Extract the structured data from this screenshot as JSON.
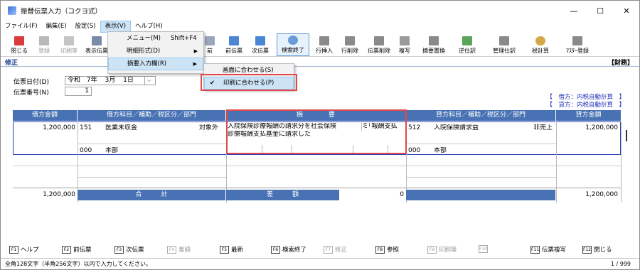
{
  "window": {
    "title": "振替伝票入力（コクヨ式）",
    "controls": {
      "minimize": "—",
      "maximize": "☐",
      "close": "✕"
    }
  },
  "menu": [
    "ファイル(F)",
    "編集(E)",
    "設定(S)",
    "表示(V)",
    "ヘルプ(H)"
  ],
  "toolbar": {
    "close": "閉じる",
    "register": "登録",
    "print": "印刷等",
    "display": "表示伝票",
    "prev": "前伝票",
    "next": "次伝票",
    "search_end": "検索終了",
    "insert_row": "行挿入",
    "delete_row": "行削除",
    "delete_voucher": "伝票削除",
    "copy": "複写",
    "summary_replace": "摘要置換",
    "reverse": "逆仕訳",
    "management": "管理仕訳",
    "tax": "税計算",
    "master": "ﾏｽﾀｰ登録",
    "more_mark": "前"
  },
  "mode": "修正",
  "department": "【財務】",
  "form": {
    "date_label": "伝票日付(D)",
    "era": "令和",
    "year": "7年",
    "month": "3月",
    "day": "1日",
    "number_label": "伝票番号(N)",
    "number": "1"
  },
  "tax_info": {
    "debit": "【　借方：内税自動計算　】",
    "credit": "【　貸方：内税自動計算　】"
  },
  "grid": {
    "headers": {
      "debit_amount": "借方金額",
      "debit_account": "借方科目／補助／税区分／部門",
      "summary": "摘　　　　要",
      "credit_account": "貸方科目／補助／税区分／部門",
      "credit_amount": "貸方金額"
    },
    "row": {
      "debit_amount": "1,200,000",
      "debit_code": "151",
      "debit_name": "医業未収金",
      "debit_tax": "対象外",
      "debit_dept_code": "000",
      "debit_dept": "本部",
      "summary_line1": "入院保険診療報酬の請求分を社会保険",
      "summary_line2": "診療報酬支払基金に請求した",
      "summary_popup": "ミ｢報酬支払",
      "credit_code": "512",
      "credit_name": "入院保険請求益",
      "credit_tax": "非売上",
      "credit_dept_code": "000",
      "credit_dept": "本部",
      "credit_amount": "1,200,000"
    },
    "totals": {
      "debit": "1,200,000",
      "label_total": "合　　　計",
      "label_diff": "差　　　額",
      "diff": "0",
      "credit": "1,200,000"
    }
  },
  "fkeys": [
    {
      "key": "F1",
      "label": "ヘルプ",
      "enabled": true
    },
    {
      "key": "F2",
      "label": "前伝票",
      "enabled": true
    },
    {
      "key": "F3",
      "label": "次伝票",
      "enabled": true
    },
    {
      "key": "F4",
      "label": "差額",
      "enabled": false
    },
    {
      "key": "F5",
      "label": "最新",
      "enabled": true
    },
    {
      "key": "F6",
      "label": "検索終了",
      "enabled": true
    },
    {
      "key": "F7",
      "label": "修正",
      "enabled": false
    },
    {
      "key": "F8",
      "label": "参照",
      "enabled": true
    },
    {
      "key": "F9",
      "label": "印刷等",
      "enabled": false
    },
    {
      "key": "F10",
      "label": "",
      "enabled": false
    },
    {
      "key": "F11",
      "label": "伝票複写",
      "enabled": true
    },
    {
      "key": "F12",
      "label": "閉じる",
      "enabled": true
    }
  ],
  "status": {
    "hint": "全角128文字（半角256文字）以内で入力してください。",
    "page": "1 / 999"
  },
  "view_menu": {
    "items": [
      {
        "label": "メニュー(M)",
        "shortcut": "Shift+F4",
        "submenu": false
      },
      {
        "label": "明細形式(D)",
        "shortcut": "",
        "submenu": true
      },
      {
        "label": "摘要入力欄(R)",
        "shortcut": "",
        "submenu": true
      }
    ],
    "submenu": [
      {
        "label": "画面に合わせる(S)",
        "checked": false
      },
      {
        "label": "印刷に合わせる(P)",
        "checked": true
      }
    ]
  },
  "icons": {
    "check": "✔",
    "submenu_arrow": "▶"
  },
  "colors": {
    "header_blue": "#4872b4",
    "highlight_red": "#e0484d",
    "selection_blue": "#1c2fb8"
  }
}
